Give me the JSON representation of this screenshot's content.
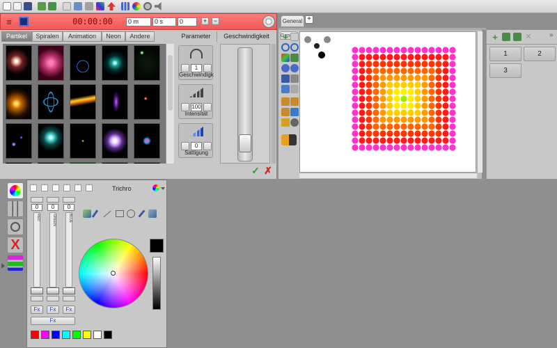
{
  "timeline": {
    "timecode": "00:00:00",
    "position": "0 m",
    "seconds": "0 s",
    "frame": "0"
  },
  "tabs": [
    {
      "label": "Partikel"
    },
    {
      "label": "Spiralen"
    },
    {
      "label": "Animation"
    },
    {
      "label": "Neon"
    },
    {
      "label": "Andere"
    }
  ],
  "parameters": {
    "header": "Parameter",
    "speed_header": "Geschwindigkeit",
    "items": [
      {
        "label": "Geschwindigkeit",
        "value": "1"
      },
      {
        "label": "Intensität",
        "value": "100"
      },
      {
        "label": "Sättigung",
        "value": "0"
      }
    ]
  },
  "stage": {
    "tab_label": "General",
    "add_tab": "+"
  },
  "right_panel": {
    "slots": [
      "1",
      "2",
      "3"
    ],
    "more": "»"
  },
  "color_panel": {
    "title": "Trichro",
    "faders": [
      {
        "label": "RED",
        "value": "0"
      },
      {
        "label": "GREEN",
        "value": "0"
      },
      {
        "label": "BLUE",
        "value": "0"
      }
    ],
    "fx_label": "Fx",
    "swatches": [
      "#ff0000",
      "#ff00ff",
      "#0000ff",
      "#00ffff",
      "#00ff00",
      "#ffff00",
      "#ffffff",
      "#000000"
    ],
    "current_color": "#000000"
  },
  "icons": {
    "confirm": "check-icon",
    "cancel": "cross-icon",
    "settings": "gear-icon"
  }
}
